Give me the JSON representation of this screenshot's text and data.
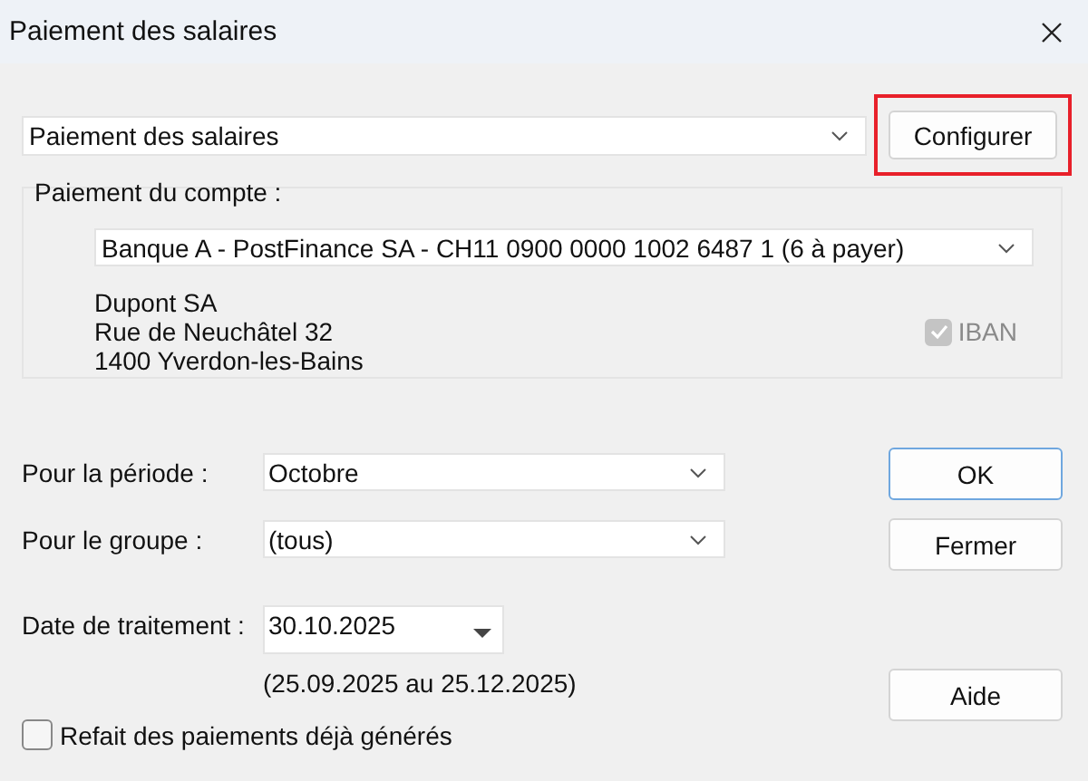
{
  "window": {
    "title": "Paiement des salaires"
  },
  "payment_type": {
    "value": "Paiement des salaires"
  },
  "configure_button": {
    "label": "Configurer",
    "highlighted": true
  },
  "account_group": {
    "label": "Paiement du compte :",
    "account": {
      "value": "Banque A - PostFinance SA - CH11 0900 0000 1002 6487 1 (6 à payer)"
    },
    "address": [
      "Dupont SA",
      "Rue de Neuchâtel 32",
      "1400 Yverdon-les-Bains"
    ],
    "iban": {
      "label": "IBAN",
      "checked": true,
      "disabled": true
    }
  },
  "fields": [
    {
      "label": "Pour la période :",
      "kind": "dropdown",
      "value": "Octobre"
    },
    {
      "label": "Pour le groupe :",
      "kind": "dropdown",
      "value": "(tous)"
    },
    {
      "label": "Date de traitement :",
      "kind": "date",
      "value": "30.10.2025",
      "hint": "(25.09.2025 au 25.12.2025)"
    }
  ],
  "buttons": [
    {
      "label": "OK",
      "default": true
    },
    {
      "label": "Fermer",
      "default": false
    },
    {
      "label": "Aide",
      "default": false
    }
  ],
  "redo_checkbox": {
    "label": "Refait des paiements déjà générés",
    "checked": false
  }
}
